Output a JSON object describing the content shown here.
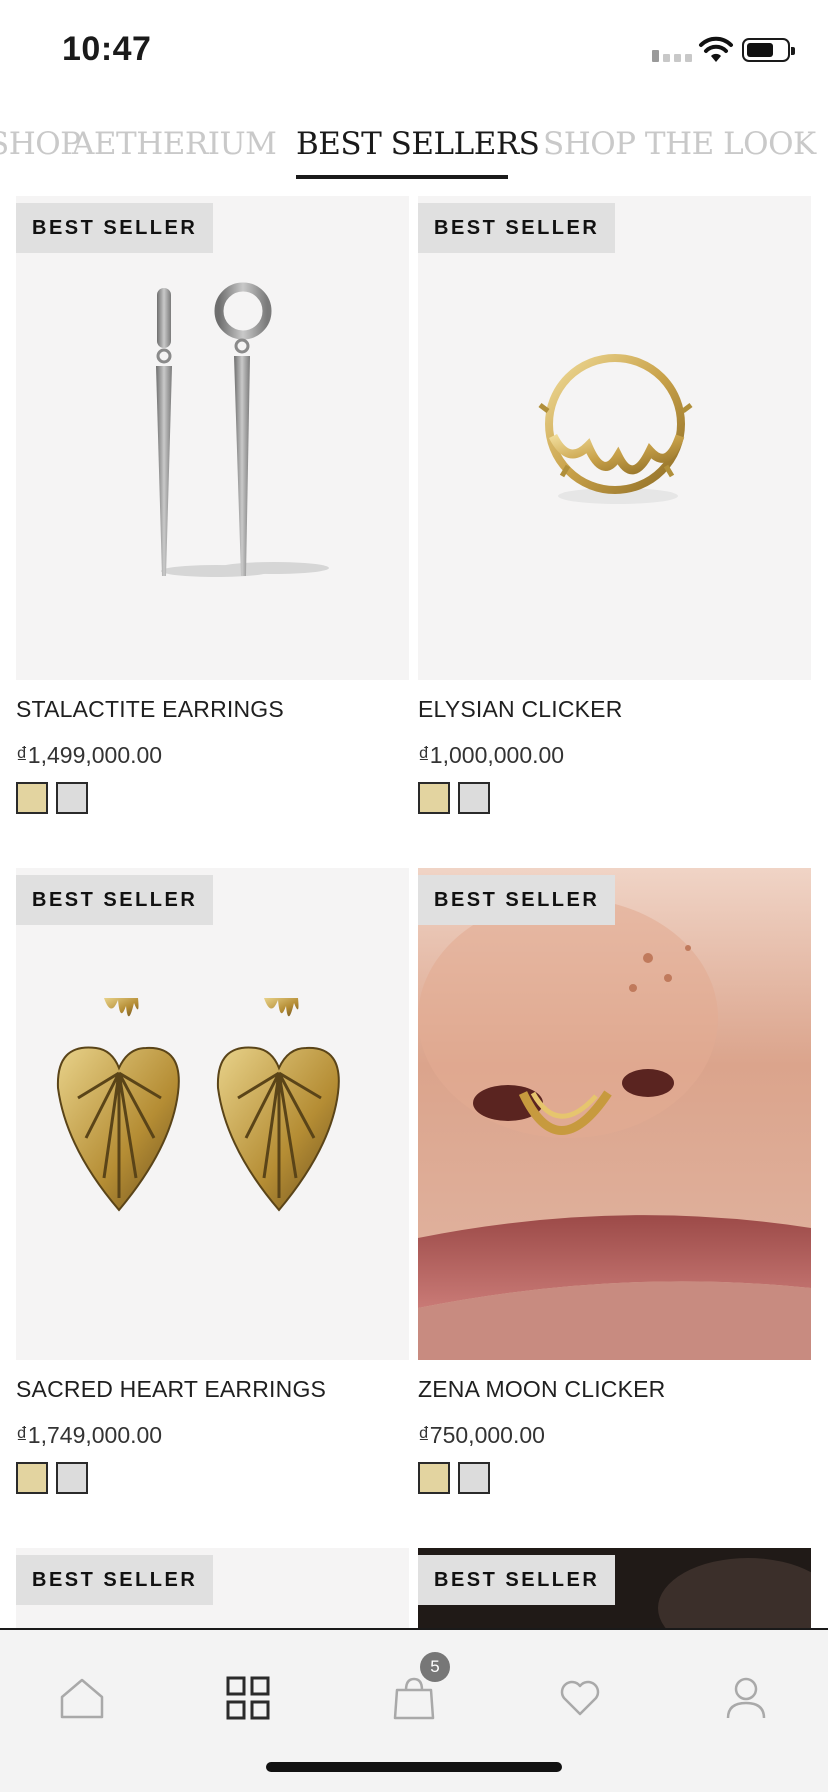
{
  "status_bar": {
    "time": "10:47"
  },
  "tabs": [
    {
      "label": "SHOP"
    },
    {
      "label": "AETHERIUM"
    },
    {
      "label": "BEST SELLERS",
      "active": true
    },
    {
      "label": "SHOP THE LOOK"
    }
  ],
  "products": [
    {
      "badge": "BEST SELLER",
      "name": "STALACTITE EARRINGS",
      "price": "₫1,499,000.00",
      "swatches": [
        "gold",
        "silver"
      ]
    },
    {
      "badge": "BEST SELLER",
      "name": "ELYSIAN CLICKER",
      "price": "₫1,000,000.00",
      "swatches": [
        "gold",
        "silver"
      ]
    },
    {
      "badge": "BEST SELLER",
      "name": "SACRED HEART EARRINGS",
      "price": "₫1,749,000.00",
      "swatches": [
        "gold",
        "silver"
      ]
    },
    {
      "badge": "BEST SELLER",
      "name": "ZENA MOON CLICKER",
      "price": "₫750,000.00",
      "swatches": [
        "gold",
        "silver"
      ]
    },
    {
      "badge": "BEST SELLER"
    },
    {
      "badge": "BEST SELLER"
    }
  ],
  "bottom_nav": {
    "items": [
      {
        "icon": "home-icon"
      },
      {
        "icon": "grid-icon",
        "active": true
      },
      {
        "icon": "bag-icon"
      },
      {
        "icon": "heart-icon"
      },
      {
        "icon": "user-icon"
      }
    ],
    "cart_count": "5"
  },
  "colors": {
    "gold_swatch": "#e3d4a0",
    "silver_swatch": "#dcdcdc",
    "badge_bg": "#e0e0e0"
  }
}
